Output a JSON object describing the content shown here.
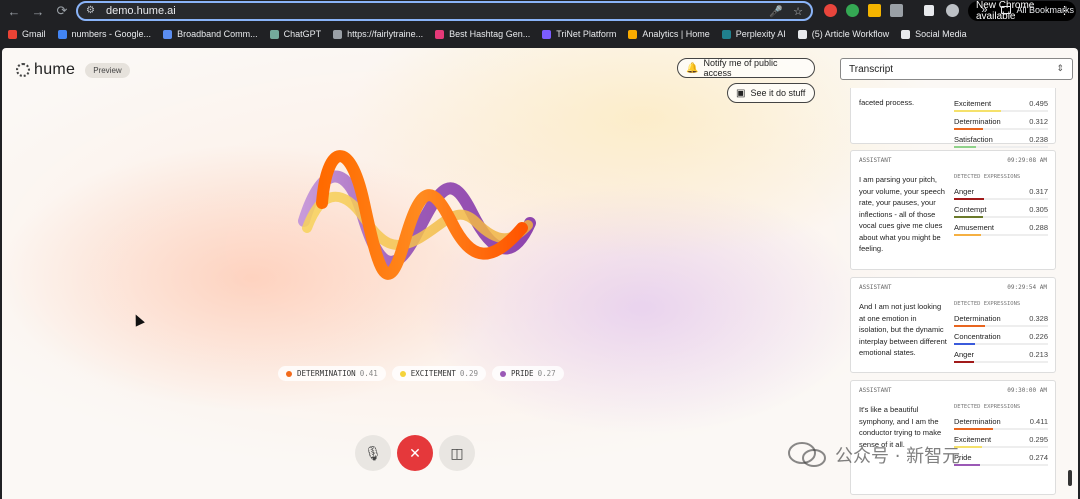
{
  "browser": {
    "url": "demo.hume.ai",
    "new_chrome_label": "New Chrome available",
    "bookmarks": [
      {
        "label": "Gmail",
        "color": "#ea4335"
      },
      {
        "label": "numbers - Google...",
        "color": "#4285f4"
      },
      {
        "label": "Broadband Comm...",
        "color": "#5b8def"
      },
      {
        "label": "ChatGPT",
        "color": "#74aa9c"
      },
      {
        "label": "https://fairlytraine...",
        "color": "#9aa0a6"
      },
      {
        "label": "Best Hashtag Gen...",
        "color": "#e53978"
      },
      {
        "label": "TriNet Platform",
        "color": "#7b5cff"
      },
      {
        "label": "Analytics | Home",
        "color": "#f9ab00"
      },
      {
        "label": "Perplexity AI",
        "color": "#20808d"
      },
      {
        "label": "(5) Article Workflow",
        "color": "#e8eaed"
      },
      {
        "label": "Social Media",
        "color": "#e8eaed"
      }
    ],
    "all_bookmarks_label": "All Bookmarks",
    "overflow_label": "»"
  },
  "app": {
    "logo_text": "hume",
    "preview_badge": "Preview",
    "notify_button": "Notify me of public access",
    "see_button": "See it do stuff",
    "transcript_select": "Transcript"
  },
  "expressions_live": [
    {
      "name": "DETERMINATION",
      "score": "0.41",
      "color": "#f26a1b"
    },
    {
      "name": "EXCITEMENT",
      "score": "0.29",
      "color": "#f5d33a"
    },
    {
      "name": "PRIDE",
      "score": "0.27",
      "color": "#9b59b6"
    }
  ],
  "controls": {
    "mic_icon": "microphone-icon",
    "end_icon": "close-icon",
    "panel_icon": "sidebar-icon"
  },
  "transcript": {
    "detected_label": "DETECTED EXPRESSIONS",
    "cards": [
      {
        "role": "",
        "time": "",
        "text": "faceted process.",
        "expressions": [
          {
            "name": "Excitement",
            "score": "0.495",
            "value": 0.495,
            "color": "#f5e16b"
          },
          {
            "name": "Determination",
            "score": "0.312",
            "value": 0.312,
            "color": "#e8651f"
          },
          {
            "name": "Satisfaction",
            "score": "0.238",
            "value": 0.238,
            "color": "#8fd28a"
          }
        ]
      },
      {
        "role": "ASSISTANT",
        "time": "09:29:08 AM",
        "text": "I am parsing your pitch, your volume, your speech rate, your pauses, your inflections - all of those vocal cues give me clues about what you might be feeling.",
        "expressions": [
          {
            "name": "Anger",
            "score": "0.317",
            "value": 0.317,
            "color": "#a11a1a"
          },
          {
            "name": "Contempt",
            "score": "0.305",
            "value": 0.305,
            "color": "#6b7a2a"
          },
          {
            "name": "Amusement",
            "score": "0.288",
            "value": 0.288,
            "color": "#f5b042"
          }
        ]
      },
      {
        "role": "ASSISTANT",
        "time": "09:29:54 AM",
        "text": "And I am not just looking at one emotion in isolation, but the dynamic interplay between different emotional states.",
        "expressions": [
          {
            "name": "Determination",
            "score": "0.328",
            "value": 0.328,
            "color": "#e8651f"
          },
          {
            "name": "Concentration",
            "score": "0.226",
            "value": 0.226,
            "color": "#3b5bdb"
          },
          {
            "name": "Anger",
            "score": "0.213",
            "value": 0.213,
            "color": "#a11a1a"
          }
        ]
      },
      {
        "role": "ASSISTANT",
        "time": "09:30:00 AM",
        "text": "It's like a beautiful symphony, and I am the conductor trying to make sense of it all.",
        "expressions": [
          {
            "name": "Determination",
            "score": "0.411",
            "value": 0.411,
            "color": "#e8651f"
          },
          {
            "name": "Excitement",
            "score": "0.295",
            "value": 0.295,
            "color": "#f5e16b"
          },
          {
            "name": "Pride",
            "score": "0.274",
            "value": 0.274,
            "color": "#9b59b6"
          }
        ]
      }
    ]
  },
  "watermark": "公众号 · 新智元"
}
